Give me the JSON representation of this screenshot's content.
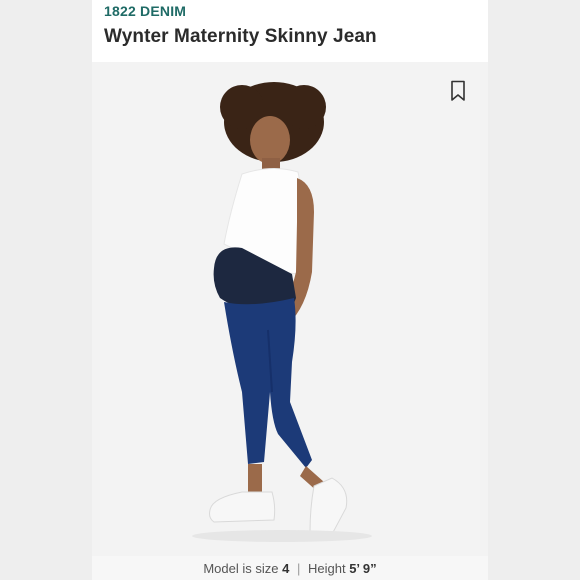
{
  "listing": {
    "brand": "1822 DENIM",
    "title": "Wynter Maternity Skinny Jean"
  },
  "photo": {
    "bookmark_icon": "bookmark-icon"
  },
  "size_info": {
    "size_label": "Model is size",
    "size_value": "4",
    "height_label": "Height",
    "height_value": "5’ 9”"
  },
  "colors": {
    "brand": "#1f6b66",
    "denim": "#1c3a78",
    "photo_bg": "#f3f3f3"
  }
}
